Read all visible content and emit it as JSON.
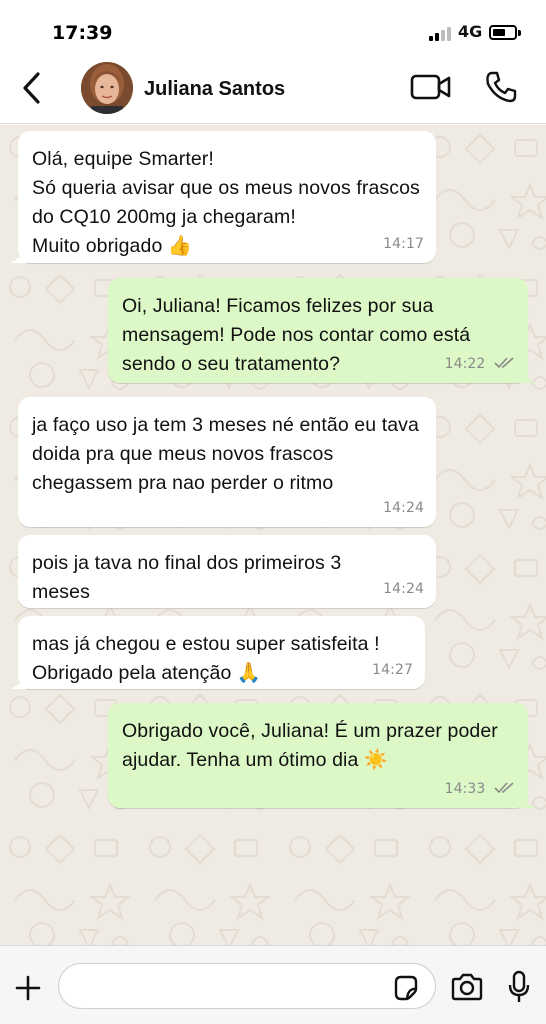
{
  "status_bar": {
    "time": "17:39",
    "network": "4G",
    "battery_level": 0.45,
    "signal_bars": 2
  },
  "header": {
    "back_icon": "chevron-left-icon",
    "contact_name": "Juliana Santos",
    "video_icon": "video-camera-icon",
    "call_icon": "phone-icon"
  },
  "messages": [
    {
      "direction": "incoming",
      "text": "Olá, equipe Smarter!\nSó queria avisar que os meus novos frascos do CQ10 200mg ja chegaram!\nMuito obrigado 👍",
      "time": "14:17"
    },
    {
      "direction": "outgoing",
      "text": "Oi, Juliana! Ficamos felizes por sua mensagem! Pode nos contar como está sendo o seu tratamento?",
      "time": "14:22",
      "status": "read"
    },
    {
      "direction": "incoming",
      "text": "ja faço uso ja tem 3 meses né então eu tava doida pra que meus novos frascos chegassem pra nao perder o ritmo",
      "time": "14:24"
    },
    {
      "direction": "incoming",
      "text": "pois ja tava no final dos primeiros 3 meses",
      "time": "14:24"
    },
    {
      "direction": "incoming",
      "text": "mas já chegou e estou super satisfeita !\nObrigado pela atenção 🙏",
      "time": "14:27"
    },
    {
      "direction": "outgoing",
      "text": "Obrigado você, Juliana! É um prazer poder ajudar. Tenha um ótimo dia ☀️",
      "time": "14:33",
      "status": "read"
    }
  ],
  "input_bar": {
    "plus_icon": "plus-icon",
    "placeholder": "",
    "sticker_icon": "sticker-icon",
    "camera_icon": "camera-icon",
    "mic_icon": "microphone-icon"
  },
  "colors": {
    "incoming_bubble": "#ffffff",
    "outgoing_bubble": "#dcf8c6",
    "wallpaper": "#efeae2",
    "timestamp": "#8a8a8a"
  }
}
